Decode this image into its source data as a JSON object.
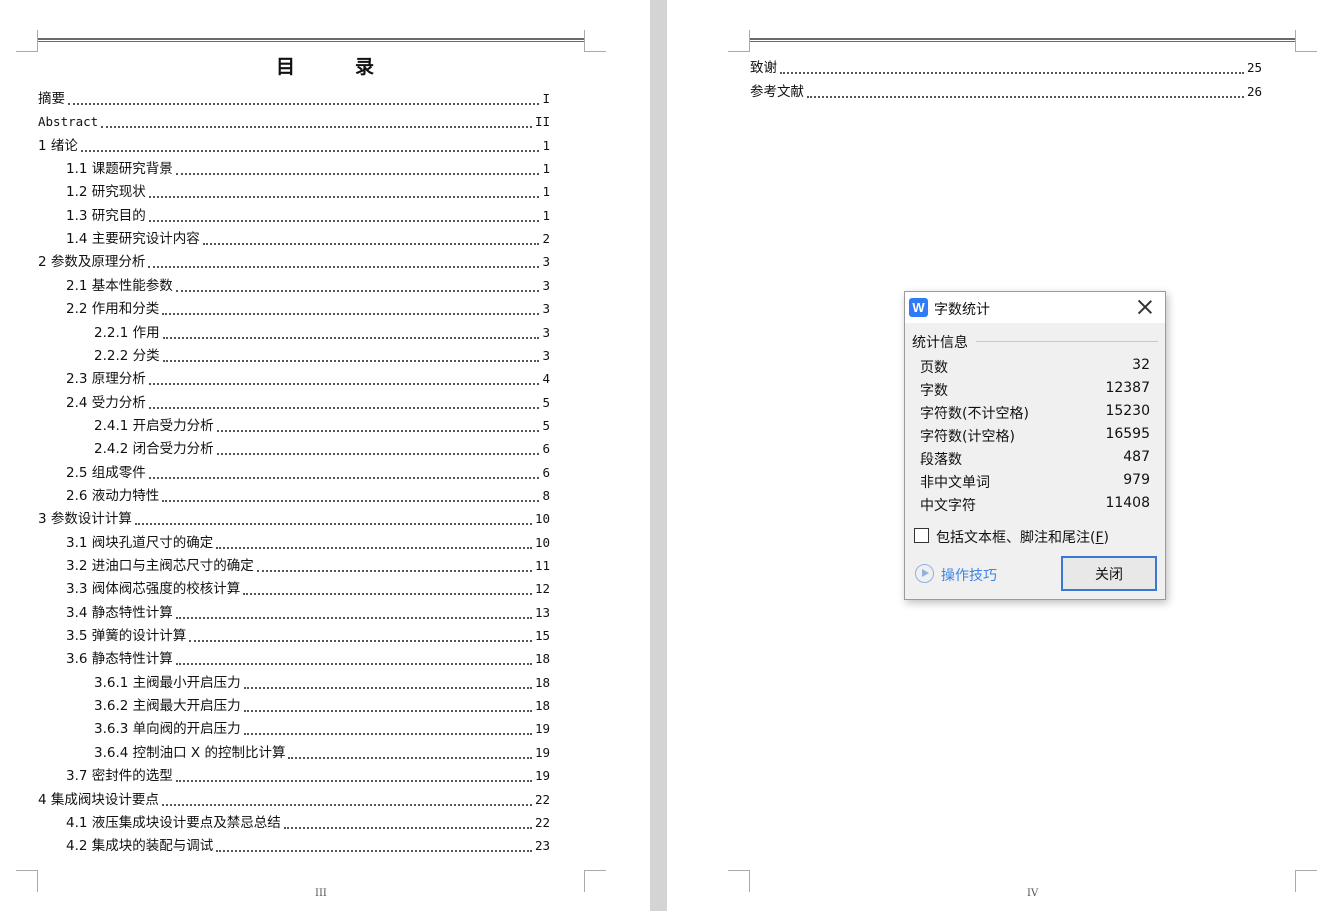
{
  "toc": {
    "title": "目录",
    "entries": [
      {
        "text": "摘要",
        "page": "I"
      },
      {
        "text": "Abstract",
        "page": "II"
      },
      {
        "text": "1 绪论",
        "page": "1"
      },
      {
        "text": "1.1 课题研究背景",
        "page": "1"
      },
      {
        "text": "1.2 研究现状",
        "page": "1"
      },
      {
        "text": "1.3 研究目的",
        "page": "1"
      },
      {
        "text": "1.4 主要研究设计内容",
        "page": "2"
      },
      {
        "text": "2 参数及原理分析",
        "page": "3"
      },
      {
        "text": "2.1 基本性能参数",
        "page": "3"
      },
      {
        "text": "2.2 作用和分类",
        "page": "3"
      },
      {
        "text": "2.2.1 作用",
        "page": "3"
      },
      {
        "text": "2.2.2 分类",
        "page": "3"
      },
      {
        "text": "2.3 原理分析",
        "page": "4"
      },
      {
        "text": "2.4 受力分析",
        "page": "5"
      },
      {
        "text": "2.4.1 开启受力分析",
        "page": "5"
      },
      {
        "text": "2.4.2 闭合受力分析",
        "page": "6"
      },
      {
        "text": "2.5 组成零件",
        "page": "6"
      },
      {
        "text": "2.6 液动力特性",
        "page": "8"
      },
      {
        "text": "3 参数设计计算",
        "page": "10"
      },
      {
        "text": "3.1 阀块孔道尺寸的确定",
        "page": "10"
      },
      {
        "text": "3.2 进油口与主阀芯尺寸的确定",
        "page": "11"
      },
      {
        "text": "3.3 阀体阀芯强度的校核计算",
        "page": "12"
      },
      {
        "text": "3.4 静态特性计算",
        "page": "13"
      },
      {
        "text": "3.5 弹簧的设计计算",
        "page": "15"
      },
      {
        "text": "3.6 静态特性计算",
        "page": "18"
      },
      {
        "text": "3.6.1 主阀最小开启压力",
        "page": "18"
      },
      {
        "text": "3.6.2 主阀最大开启压力",
        "page": "18"
      },
      {
        "text": "3.6.3 单向阀的开启压力",
        "page": "19"
      },
      {
        "text": "3.6.4 控制油口 X 的控制比计算",
        "page": "19"
      },
      {
        "text": "3.7 密封件的选型",
        "page": "19"
      },
      {
        "text": "4 集成阀块设计要点",
        "page": "22"
      },
      {
        "text": "4.1 液压集成块设计要点及禁忌总结",
        "page": "22"
      },
      {
        "text": "4.2 集成块的装配与调试",
        "page": "23"
      }
    ],
    "entries_right": [
      {
        "text": "致谢",
        "page": "25"
      },
      {
        "text": "参考文献",
        "page": "26"
      }
    ]
  },
  "footer": {
    "left_page": "III",
    "right_page": "IV"
  },
  "dialog": {
    "logo": "W",
    "title": "字数统计",
    "group_label": "统计信息",
    "stats": [
      {
        "label": "页数",
        "value": "32"
      },
      {
        "label": "字数",
        "value": "12387"
      },
      {
        "label": "字符数(不计空格)",
        "value": "15230"
      },
      {
        "label": "字符数(计空格)",
        "value": "16595"
      },
      {
        "label": "段落数",
        "value": "487"
      },
      {
        "label": "非中文单词",
        "value": "979"
      },
      {
        "label": "中文字符",
        "value": "11408"
      }
    ],
    "checkbox_label": "包括文本框、脚注和尾注(",
    "checkbox_accel": "F",
    "checkbox_label_end": ")",
    "checkbox_checked": false,
    "tips_label": "操作技巧",
    "close_label": "关闭",
    "accent_color": "#3a78d6"
  }
}
